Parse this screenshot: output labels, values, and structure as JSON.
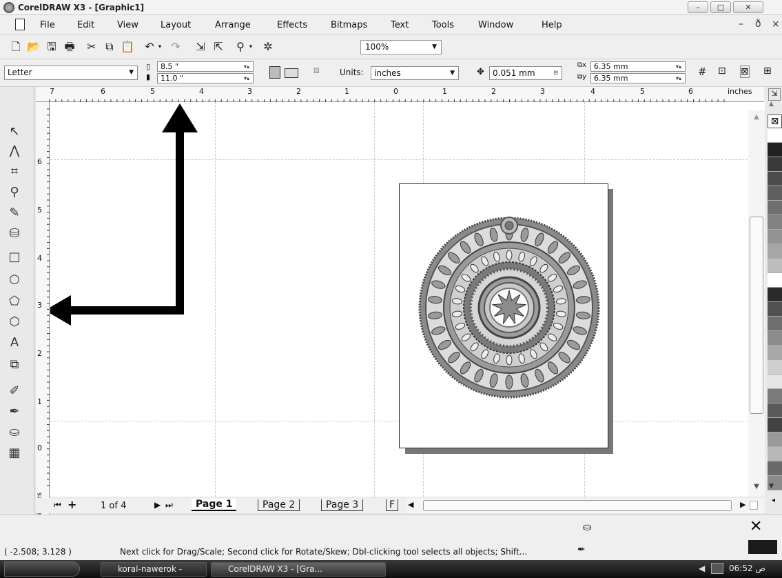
{
  "window": {
    "title": "CorelDRAW X3 - [Graphic1]",
    "minimize": "–",
    "maximize": "□",
    "close": "✕"
  },
  "menu": [
    "File",
    "Edit",
    "View",
    "Layout",
    "Arrange",
    "Effects",
    "Bitmaps",
    "Text",
    "Tools",
    "Window",
    "Help"
  ],
  "mdi": {
    "minimize": "–",
    "restore": "ð",
    "close": "×"
  },
  "toolbar": {
    "zoom": "100%"
  },
  "propbar": {
    "paper": "Letter",
    "width": "8.5 \"",
    "height": "11.0 \"",
    "units_label": "Units:",
    "units": "inches",
    "nudge": "0.051 mm",
    "dup_x": "6.35 mm",
    "dup_y": "6.35 mm"
  },
  "hruler": {
    "labels": [
      "7",
      "6",
      "5",
      "4",
      "3",
      "2",
      "1",
      "0",
      "1",
      "2",
      "3",
      "4",
      "5",
      "6"
    ],
    "unit": "inches"
  },
  "vruler": {
    "labels": [
      "6",
      "5",
      "4",
      "3",
      "2",
      "1",
      "0"
    ],
    "unit": "inches"
  },
  "pages": {
    "counter": "1 of 4",
    "tabs": [
      "Page 1",
      "Page 2",
      "Page 3",
      "F"
    ]
  },
  "status": {
    "coords": "( -2.508; 3.128 )",
    "message": "Next click for Drag/Scale; Second click for Rotate/Skew; Dbl-clicking tool selects all objects; Shift..."
  },
  "palette": [
    "#ffffff",
    "#222222",
    "#3a3a3a",
    "#4c4c4c",
    "#5e5e5e",
    "#707070",
    "#828282",
    "#949494",
    "#a6a6a6",
    "#bdbdbd",
    "#ffffff",
    "#2a2a2a",
    "#505050",
    "#6e6e6e",
    "#8c8c8c",
    "#a8a8a8",
    "#cfcfcf",
    "#e5e5e5",
    "#7a7a7a",
    "#5a5a5a",
    "#424242",
    "#9a9a9a",
    "#b8b8b8",
    "#6a6a6a",
    "#8a8a8a",
    "#3e3e3e"
  ],
  "taskbar": {
    "tasks": [
      "koral-nawerok - Micro...",
      "CorelDRAW X3 - [Gra..."
    ],
    "clock": "06:52 ص"
  },
  "icons": {
    "tools": [
      "pick-tool-icon",
      "shape-tool-icon",
      "crop-tool-icon",
      "zoom-tool-icon",
      "freehand-tool-icon",
      "smart-fill-tool-icon",
      "rectangle-tool-icon",
      "ellipse-tool-icon",
      "polygon-tool-icon",
      "basic-shapes-tool-icon",
      "text-tool-icon",
      "interactive-blend-tool-icon",
      "eyedropper-tool-icon",
      "outline-tool-icon",
      "fill-tool-icon",
      "interactive-fill-tool-icon"
    ]
  }
}
